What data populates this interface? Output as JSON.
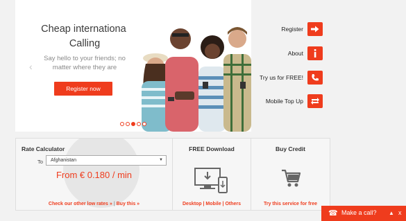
{
  "hero": {
    "title_line1": "Cheap international",
    "title_line2": "Calling",
    "subtitle_line1": "Say hello to your friends; no",
    "subtitle_line2": "matter where they are",
    "register_button": "Register now",
    "prev_arrow": "‹",
    "slides": 5,
    "active_slide": 3
  },
  "side_nav": [
    {
      "label": "Register",
      "icon": "arrow-right-icon"
    },
    {
      "label": "About",
      "icon": "info-icon"
    },
    {
      "label": "Try us for FREE!",
      "icon": "phone-icon"
    },
    {
      "label": "Mobile Top Up",
      "icon": "swap-arrows-icon"
    }
  ],
  "rate_calculator": {
    "title": "Rate Calculator",
    "to_label": "To",
    "selected_country": "Afghanistan",
    "price": "From € 0.180 / min",
    "link_rates": "Check our other low rates »",
    "separator": "|",
    "link_buy": "Buy this »"
  },
  "free_download": {
    "title": "FREE Download",
    "platforms": "Desktop | Mobile | Others"
  },
  "buy_credit": {
    "title": "Buy Credit",
    "link": "Try this service for free"
  },
  "call_bar": {
    "label": "Make a call?",
    "expand": "▲",
    "close": "x"
  },
  "colors": {
    "accent": "#ef3c1d",
    "panel_bg": "#f6f6f6"
  }
}
